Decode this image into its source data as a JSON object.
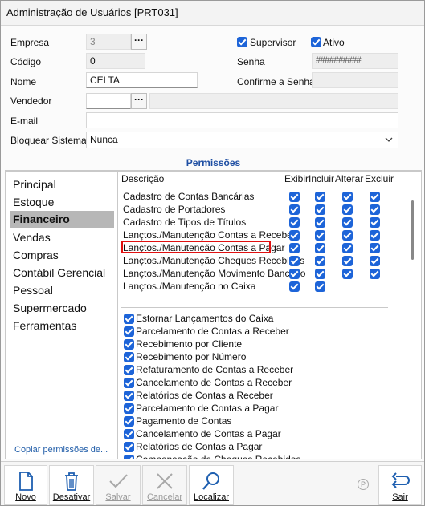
{
  "window": {
    "title": "Administração de Usuários [PRT031]"
  },
  "form": {
    "empresa_label": "Empresa",
    "empresa_value": "3",
    "codigo_label": "Código",
    "codigo_value": "0",
    "nome_label": "Nome",
    "nome_value": "CELTA",
    "vendedor_label": "Vendedor",
    "vendedor_value": "",
    "vendedor_desc": "",
    "email_label": "E-mail",
    "email_value": "",
    "bloquear_label": "Bloquear Sistema",
    "bloquear_value": "Nunca",
    "supervisor_label": "Supervisor",
    "supervisor_checked": true,
    "ativo_label": "Ativo",
    "ativo_checked": true,
    "senha_label": "Senha",
    "senha_value": "##########",
    "confirme_label": "Confirme a Senha",
    "confirme_value": "",
    "ellipsis": "···"
  },
  "permissions": {
    "title": "Permissões",
    "modules": [
      "Principal",
      "Estoque",
      "Financeiro",
      "Vendas",
      "Compras",
      "Contábil Gerencial",
      "Pessoal",
      "Supermercado",
      "Ferramentas"
    ],
    "selected_module": "Financeiro",
    "copy_link": "Copiar permissões de...",
    "columns": {
      "descricao": "Descrição",
      "exibir": "Exibir",
      "incluir": "Incluir",
      "alterar": "Alterar",
      "excluir": "Excluir"
    },
    "rows": [
      {
        "label": "Cadastro de Contas Bancárias",
        "exibir": true,
        "incluir": true,
        "alterar": true,
        "excluir": true
      },
      {
        "label": "Cadastro de Portadores",
        "exibir": true,
        "incluir": true,
        "alterar": true,
        "excluir": true
      },
      {
        "label": "Cadastro de Tipos de Títulos",
        "exibir": true,
        "incluir": true,
        "alterar": true,
        "excluir": true
      },
      {
        "label": "Lançtos./Manutenção Contas a Receber",
        "exibir": true,
        "incluir": true,
        "alterar": true,
        "excluir": true
      },
      {
        "label": "Lançtos./Manutenção Contas a Pagar",
        "exibir": true,
        "incluir": true,
        "alterar": true,
        "excluir": true
      },
      {
        "label": "Lançtos./Manutenção Cheques Recebidos",
        "exibir": true,
        "incluir": true,
        "alterar": true,
        "excluir": true
      },
      {
        "label": "Lançtos./Manutenção Movimento Bancário",
        "exibir": true,
        "incluir": true,
        "alterar": true,
        "excluir": true
      },
      {
        "label": "Lançtos./Manutenção no Caixa",
        "exibir": true,
        "incluir": true,
        "alterar": false,
        "excluir": false
      }
    ],
    "highlighted_row": "Lançtos./Manutenção Contas a Pagar",
    "extra_items": [
      "Estornar Lançamentos do Caixa",
      "Parcelamento de Contas a Receber",
      "Recebimento por Cliente",
      "Recebimento por Número",
      "Refaturamento de Contas a Receber",
      "Cancelamento de Contas a Receber",
      "Relatórios de Contas a Receber",
      "Parcelamento de Contas a Pagar",
      "Pagamento de Contas",
      "Cancelamento de Contas a Pagar",
      "Relatórios de Contas a Pagar",
      "Compensação de Cheques Recebidos"
    ]
  },
  "toolbar": {
    "novo": "Novo",
    "desativar": "Desativar",
    "salvar": "Salvar",
    "cancelar": "Cancelar",
    "localizar": "Localizar",
    "sair": "Sair",
    "p_mark": "P"
  },
  "colors": {
    "accent": "#1d64d8",
    "highlight": "#e01010",
    "header_text": "#1f4fa3"
  }
}
